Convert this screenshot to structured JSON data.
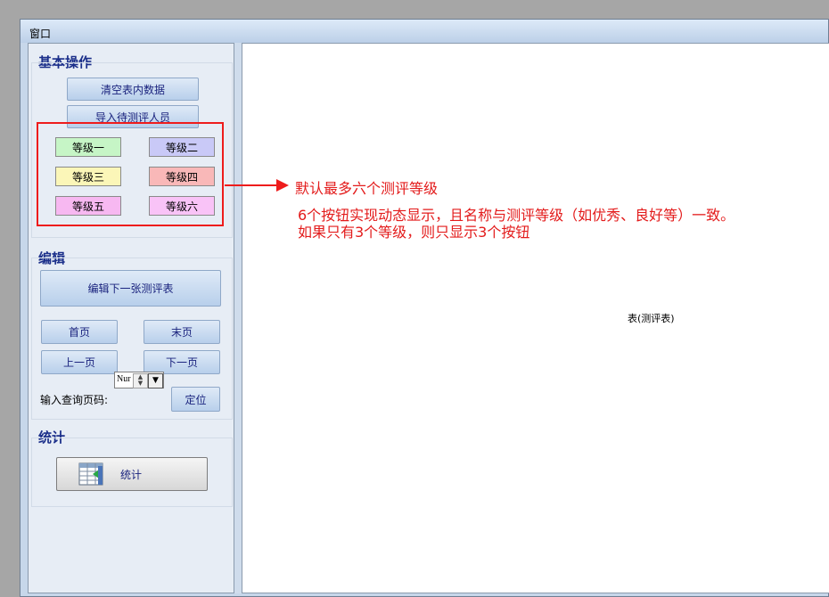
{
  "window": {
    "title": "窗口"
  },
  "sections": {
    "basic": "基本操作",
    "edit": "编辑",
    "stats": "统计"
  },
  "buttons": {
    "clear_table": "清空表内数据",
    "import": "导入待测评人员",
    "edit_next": "编辑下一张测评表",
    "first": "首页",
    "last": "末页",
    "prev": "上一页",
    "next": "下一页",
    "locate": "定位",
    "stats": "统计"
  },
  "levels": [
    {
      "label": "等级一",
      "color": "#c6f5c6"
    },
    {
      "label": "等级二",
      "color": "#c9c9f7"
    },
    {
      "label": "等级三",
      "color": "#fbf6b8"
    },
    {
      "label": "等级四",
      "color": "#f9b8b8"
    },
    {
      "label": "等级五",
      "color": "#f7b8f1"
    },
    {
      "label": "等级六",
      "color": "#f9c3f7"
    }
  ],
  "page_query": {
    "label": "输入查询页码:",
    "placeholder": "Nur"
  },
  "content": {
    "label": "表(测评表)"
  },
  "annotations": {
    "line1": "默认最多六个测评等级",
    "line2": "6个按钮实现动态显示，且名称与测评等级（如优秀、良好等）一致。",
    "line3": "如果只有3个等级，则只显示3个按钮"
  },
  "colors": {
    "annotation": "#e31b1b",
    "section_title": "#1b2f8a"
  }
}
